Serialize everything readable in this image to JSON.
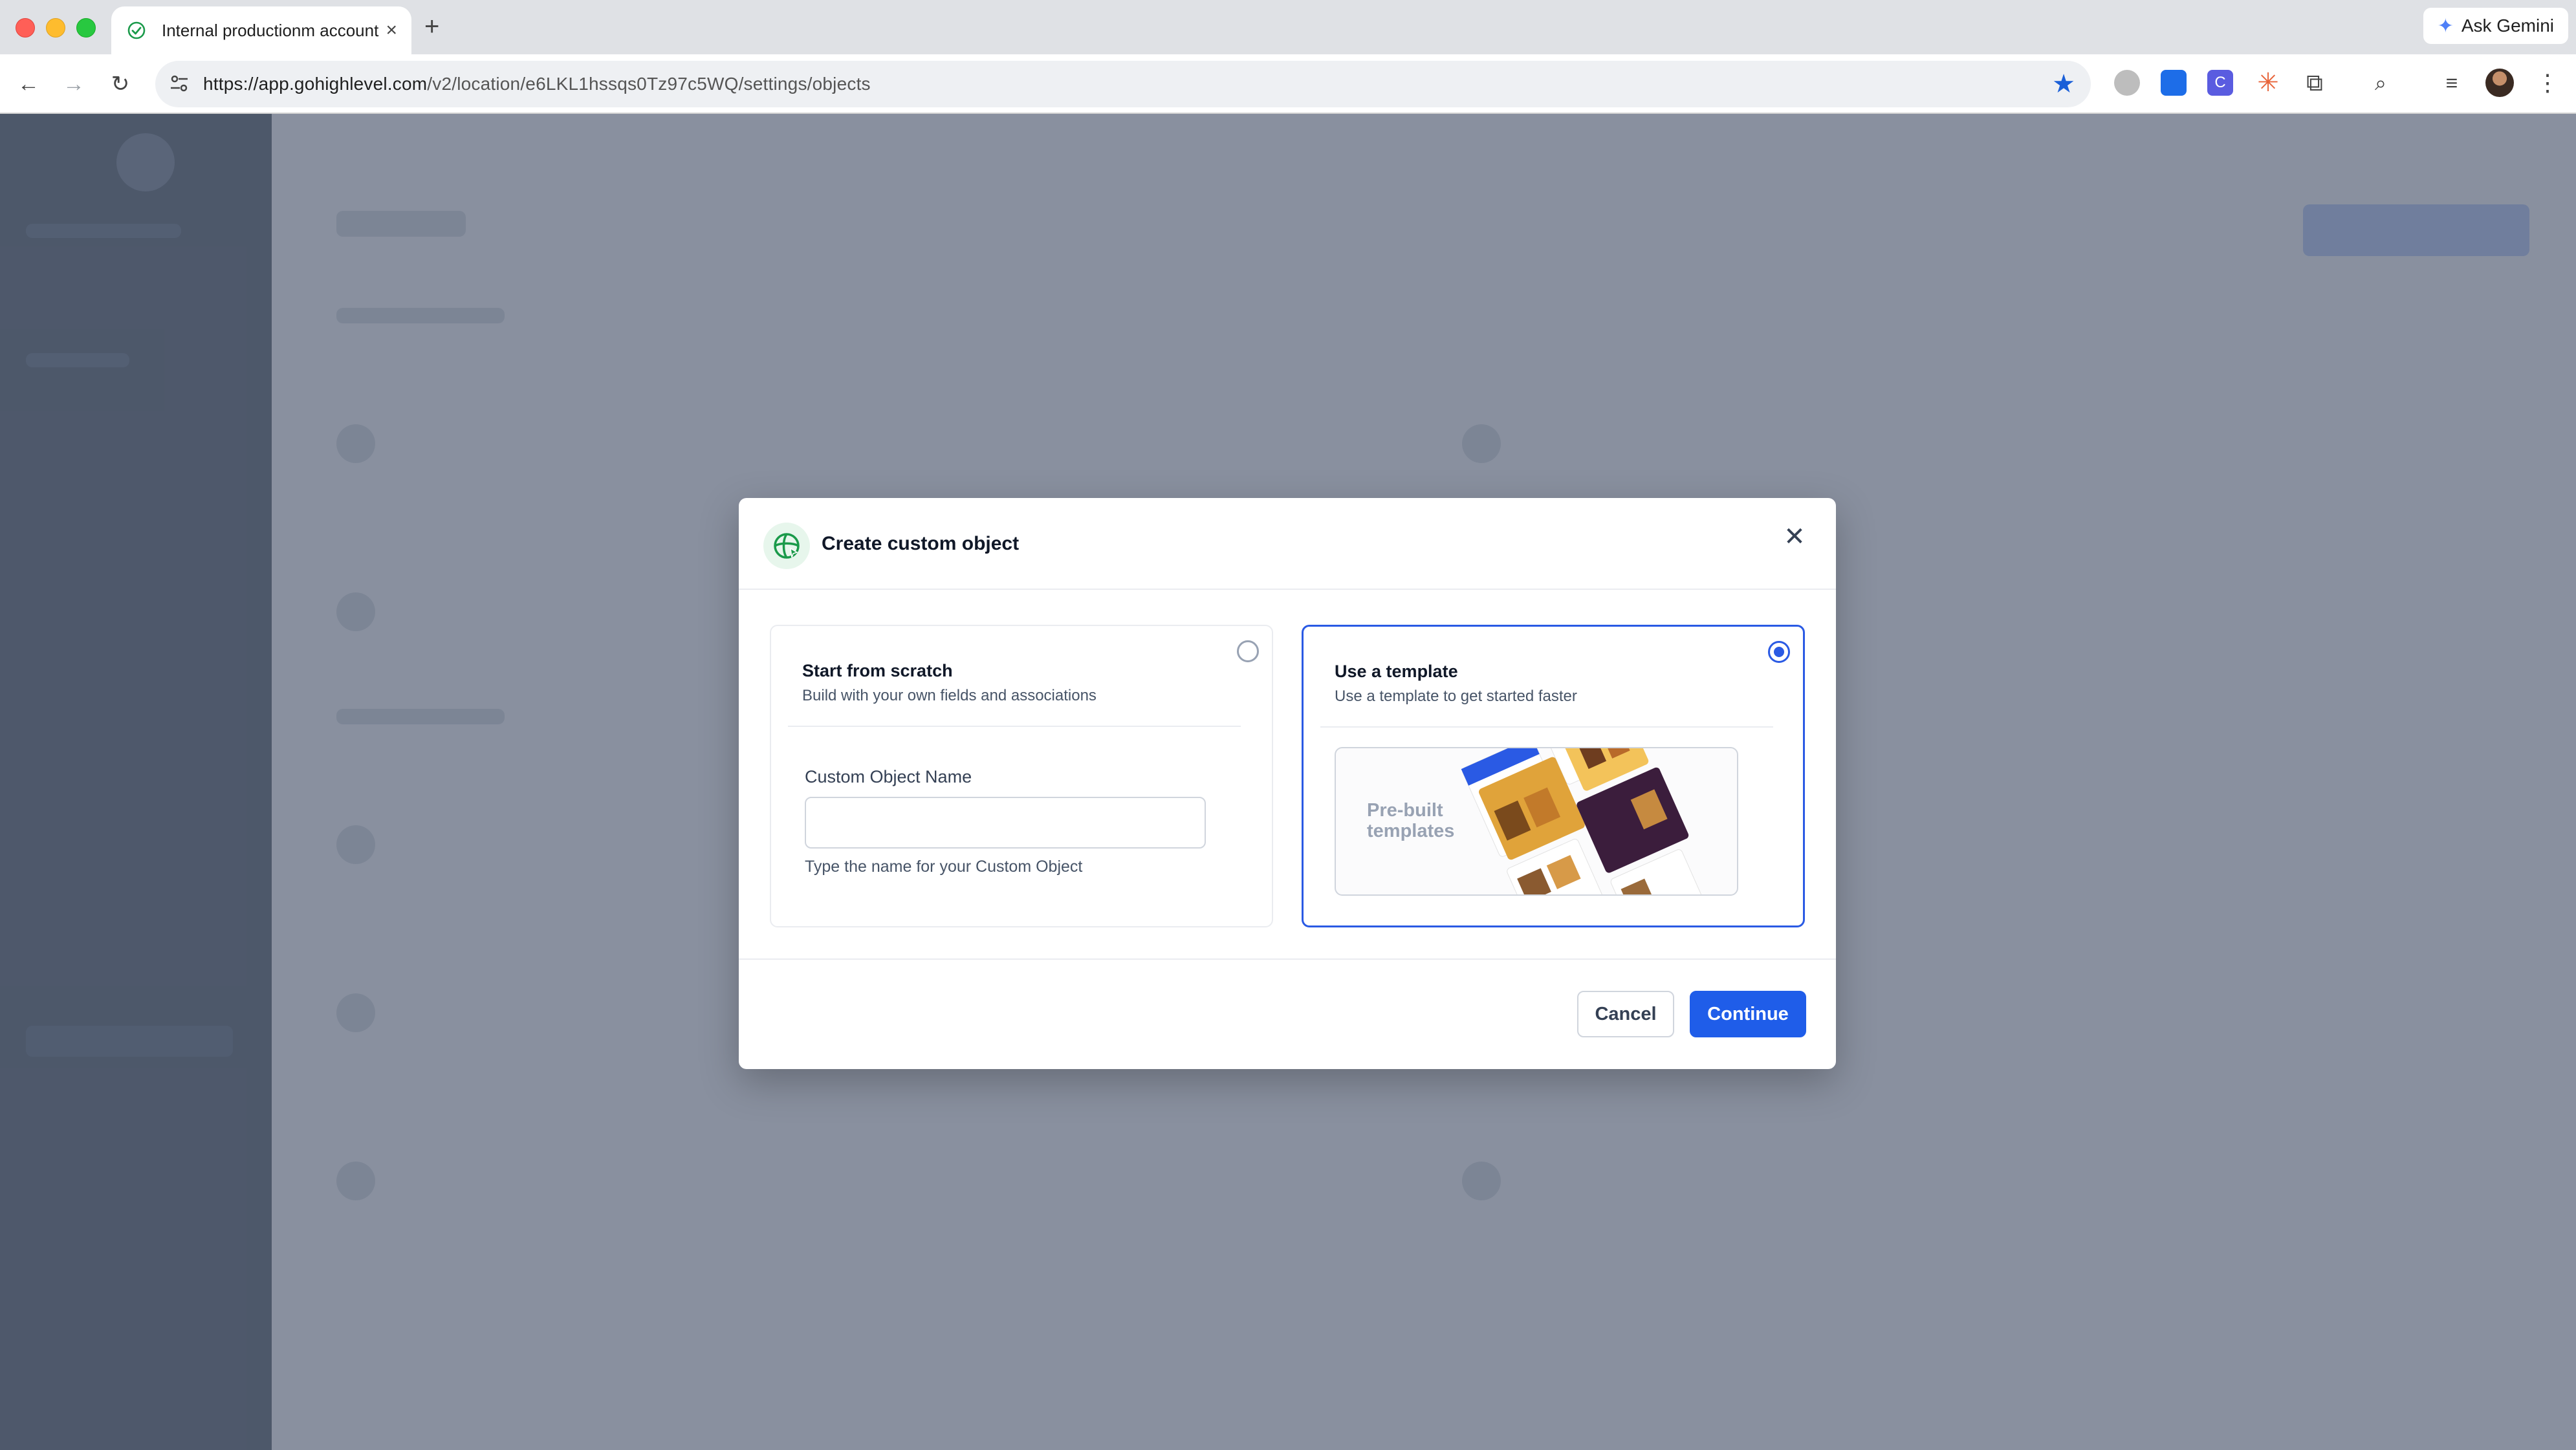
{
  "browser": {
    "tab_title": "Internal productionm account",
    "new_tab_symbol": "+",
    "tab_close_symbol": "×",
    "ask_gemini_label": "Ask Gemini",
    "url_host": "https://app.gohighlevel.com",
    "url_path": "/v2/location/e6LKL1hssqs0Tz97c5WQ/settings/objects"
  },
  "modal": {
    "title": "Create custom object",
    "close_symbol": "✕",
    "option_scratch": {
      "title": "Start from scratch",
      "subtitle": "Build with your own fields and associations",
      "selected": false,
      "field_label": "Custom Object Name",
      "field_value": "",
      "field_placeholder": "",
      "field_help": "Type the name for your Custom Object"
    },
    "option_template": {
      "title": "Use a template",
      "subtitle": "Use a template to get started faster",
      "selected": true,
      "preview_label": "Pre-built templates"
    },
    "cancel_label": "Cancel",
    "continue_label": "Continue"
  },
  "colors": {
    "accent": "#1f5de9",
    "overlay": "#606a7d",
    "sidebar": "#1e2b3c",
    "brand_green": "#1a9a4a"
  },
  "icons": {
    "tab_favicon": "check-circle-icon",
    "modal_icon": "custom-object-icon",
    "bookmark": "star-icon"
  }
}
